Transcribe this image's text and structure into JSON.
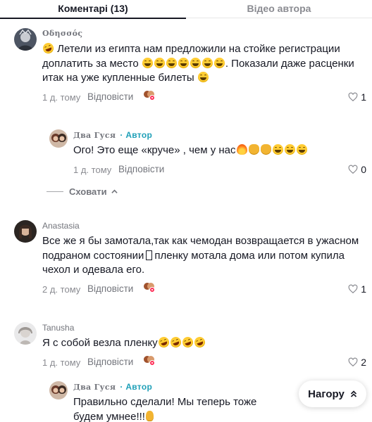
{
  "tabs": {
    "comments": "Коментарі (13)",
    "author_videos": "Відео автора"
  },
  "comments": [
    {
      "username": "Οδησσός",
      "text_1": "Летели из египта нам предложили на стойке регистрации доплатить за место",
      "text_2": ". Показали даже расценки итак на уже купленные билеты",
      "time": "1 д. тому",
      "reply_label": "Відповісти",
      "likes": "1"
    },
    {
      "username": "Anastasia",
      "text_1": "Все же я бы замотала,так как чемодан возвращается в ужасном подраном состоянии",
      "text_2": "пленку мотала дома или потом купила чехол и одевала его.",
      "time": "2 д. тому",
      "reply_label": "Відповісти",
      "likes": "1"
    },
    {
      "username": "Tanusha",
      "text_1": "Я с собой везла пленку",
      "time": "1 д. тому",
      "reply_label": "Відповісти",
      "likes": "2"
    }
  ],
  "replies": [
    {
      "username": "Два Гуся",
      "author_tag": "· Автор",
      "text_1": "Ого! Это еще «круче» , чем у нас",
      "time": "1 д. тому",
      "reply_label": "Відповісти",
      "likes": "0"
    },
    {
      "username": "Два Гуся",
      "author_tag": "· Автор",
      "text_1": "Правильно сделали! Мы теперь тоже будем умнее!!!"
    }
  ],
  "hide_replies": "Сховати",
  "scroll_top": "Нагору",
  "colors": {
    "author_accent": "#20a0b8",
    "text_primary": "#161823",
    "text_secondary": "#8a8b91",
    "liked_badge": "#fe2c55"
  }
}
